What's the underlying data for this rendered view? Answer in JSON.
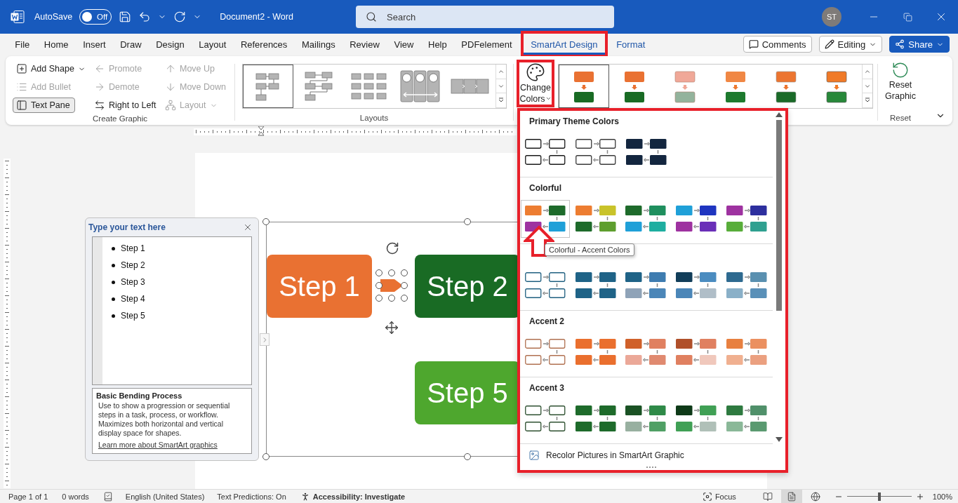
{
  "title_bar": {
    "autosave": {
      "label": "AutoSave",
      "on": false,
      "state": "Off"
    },
    "document_title": "Document2 - Word",
    "search": {
      "placeholder": "Search"
    },
    "avatar": "ST"
  },
  "menu_tabs": [
    {
      "label": "File",
      "selected": false,
      "contextual": false,
      "annotated": false
    },
    {
      "label": "Home",
      "selected": false,
      "contextual": false,
      "annotated": false
    },
    {
      "label": "Insert",
      "selected": false,
      "contextual": false,
      "annotated": false
    },
    {
      "label": "Draw",
      "selected": false,
      "contextual": false,
      "annotated": false
    },
    {
      "label": "Design",
      "selected": false,
      "contextual": false,
      "annotated": false
    },
    {
      "label": "Layout",
      "selected": false,
      "contextual": false,
      "annotated": false
    },
    {
      "label": "References",
      "selected": false,
      "contextual": false,
      "annotated": false
    },
    {
      "label": "Mailings",
      "selected": false,
      "contextual": false,
      "annotated": false
    },
    {
      "label": "Review",
      "selected": false,
      "contextual": false,
      "annotated": false
    },
    {
      "label": "View",
      "selected": false,
      "contextual": false,
      "annotated": false
    },
    {
      "label": "Help",
      "selected": false,
      "contextual": false,
      "annotated": false
    },
    {
      "label": "PDFelement",
      "selected": false,
      "contextual": false,
      "annotated": false
    },
    {
      "label": "SmartArt Design",
      "selected": true,
      "contextual": true,
      "annotated": true
    },
    {
      "label": "Format",
      "selected": false,
      "contextual": true,
      "annotated": false
    }
  ],
  "header_buttons": [
    {
      "label": "Comments",
      "kind": "comments"
    },
    {
      "label": "Editing",
      "kind": "editing"
    },
    {
      "label": "Share",
      "kind": "share"
    }
  ],
  "ribbon": {
    "create_graphic": {
      "label": "Create Graphic",
      "commands": [
        {
          "label": "Add Shape",
          "kind": "add",
          "disabled": false,
          "pressed": false,
          "has_menu": true
        },
        {
          "label": "Add Bullet",
          "kind": "bullet",
          "disabled": true,
          "pressed": false,
          "has_menu": false
        },
        {
          "label": "Text Pane",
          "kind": "pane",
          "disabled": false,
          "pressed": true,
          "has_menu": false
        },
        {
          "label": "Promote",
          "kind": "promote",
          "disabled": true,
          "pressed": false,
          "has_menu": false
        },
        {
          "label": "Demote",
          "kind": "demote",
          "disabled": true,
          "pressed": false,
          "has_menu": false
        },
        {
          "label": "Right to Left",
          "kind": "direction",
          "disabled": false,
          "pressed": false,
          "has_menu": false
        },
        {
          "label": "Move Up",
          "kind": "up",
          "disabled": true,
          "pressed": false,
          "has_menu": false
        },
        {
          "label": "Move Down",
          "kind": "down",
          "disabled": true,
          "pressed": false,
          "has_menu": false
        },
        {
          "label": "Layout",
          "kind": "layout",
          "disabled": true,
          "pressed": false,
          "has_menu": true
        }
      ]
    },
    "layouts": {
      "label": "Layouts",
      "items": [
        {
          "kind": "bending",
          "selected": true
        },
        {
          "kind": "alternating",
          "selected": false
        },
        {
          "kind": "grid",
          "selected": false
        },
        {
          "kind": "circles",
          "selected": false
        },
        {
          "kind": "chevron",
          "selected": false
        }
      ]
    },
    "smartart_styles": {
      "change_colors": {
        "label": "Change Colors",
        "annotated": true
      },
      "items": [
        {
          "kind": "flat",
          "selected": true
        },
        {
          "kind": "flat",
          "selected": false
        },
        {
          "kind": "light",
          "selected": false
        },
        {
          "kind": "gradient",
          "selected": false
        },
        {
          "kind": "shadow",
          "selected": false
        },
        {
          "kind": "glossy",
          "selected": false
        }
      ]
    },
    "reset": {
      "button": "Reset Graphic",
      "label": "Reset"
    }
  },
  "text_pane": {
    "title": "Type your text here",
    "items": [
      "Step 1",
      "Step 2",
      "Step 3",
      "Step 4",
      "Step 5"
    ],
    "layout_name": "Basic Bending Process",
    "description": "Use to show a progression or sequential steps in a task, process, or workflow. Maximizes both horizontal and vertical display space for shapes.",
    "link": "Learn more about SmartArt graphics"
  },
  "smartart": {
    "shapes": [
      {
        "text": "Step 1",
        "color": "#e97132"
      },
      {
        "text": "Step 2",
        "color": "#196b24"
      },
      {
        "text": "Step 5",
        "color": "#4ea72e"
      }
    ]
  },
  "colors_menu": {
    "annotated": true,
    "sections": [
      {
        "title": "Primary Theme Colors",
        "swatches": [
          {
            "kind": "outline",
            "selected": false,
            "boxes": [
              {
                "color": "#1a1a1a"
              },
              {
                "color": "#1a1a1a"
              },
              {
                "color": "#1a1a1a"
              },
              {
                "color": "#1a1a1a"
              }
            ]
          },
          {
            "kind": "outline",
            "selected": false,
            "boxes": [
              {
                "color": "#3a3a3a"
              },
              {
                "color": "#3a3a3a"
              },
              {
                "color": "#3a3a3a"
              },
              {
                "color": "#3a3a3a"
              }
            ]
          },
          {
            "kind": "fill",
            "selected": false,
            "boxes": [
              {
                "color": "#13263f"
              },
              {
                "color": "#13263f"
              },
              {
                "color": "#13263f"
              },
              {
                "color": "#13263f"
              }
            ]
          }
        ]
      },
      {
        "title": "Colorful",
        "swatches": [
          {
            "kind": "fill",
            "selected": true,
            "boxes": [
              {
                "color": "#ed7d31"
              },
              {
                "color": "#1e6b2b"
              },
              {
                "color": "#9e32a0"
              },
              {
                "color": "#1fa0d8"
              }
            ]
          },
          {
            "kind": "fill",
            "selected": false,
            "boxes": [
              {
                "color": "#ed7d31"
              },
              {
                "color": "#c9c32a"
              },
              {
                "color": "#1e6b2b"
              },
              {
                "color": "#5e9e2e"
              }
            ]
          },
          {
            "kind": "fill",
            "selected": false,
            "boxes": [
              {
                "color": "#1e6b2b"
              },
              {
                "color": "#1f8f5e"
              },
              {
                "color": "#1fa0d8"
              },
              {
                "color": "#1eaea0"
              }
            ]
          },
          {
            "kind": "fill",
            "selected": false,
            "boxes": [
              {
                "color": "#1fa0d8"
              },
              {
                "color": "#1f35c0"
              },
              {
                "color": "#9e32a0"
              },
              {
                "color": "#6a2fb8"
              }
            ]
          },
          {
            "kind": "fill",
            "selected": false,
            "boxes": [
              {
                "color": "#9e32a0"
              },
              {
                "color": "#2d2f9e"
              },
              {
                "color": "#58ad3a"
              },
              {
                "color": "#2fa090"
              }
            ]
          }
        ]
      },
      {
        "swatches": [
          {
            "kind": "outline",
            "selected": false,
            "boxes": [
              {
                "color": "#1f5f80"
              },
              {
                "color": "#1f5f80"
              },
              {
                "color": "#1f5f80"
              },
              {
                "color": "#1f5f80"
              }
            ]
          },
          {
            "kind": "fill",
            "selected": false,
            "boxes": [
              {
                "color": "#1f6387"
              },
              {
                "color": "#1f6387"
              },
              {
                "color": "#1f6387"
              },
              {
                "color": "#1f6387"
              }
            ]
          },
          {
            "kind": "fill",
            "selected": false,
            "boxes": [
              {
                "color": "#1f6387"
              },
              {
                "color": "#3e7cb0"
              },
              {
                "color": "#8fa3b8"
              },
              {
                "color": "#4b86b8"
              }
            ]
          },
          {
            "kind": "fill",
            "selected": false,
            "boxes": [
              {
                "color": "#123e5a"
              },
              {
                "color": "#4b8cc0"
              },
              {
                "color": "#4b86b8"
              },
              {
                "color": "#b0bec8"
              }
            ]
          },
          {
            "kind": "fill",
            "selected": false,
            "boxes": [
              {
                "color": "#2e6a90"
              },
              {
                "color": "#5a90b0"
              },
              {
                "color": "#8ab0c8"
              },
              {
                "color": "#5a90b8"
              }
            ]
          }
        ]
      },
      {
        "title": "Accent 2",
        "swatches": [
          {
            "kind": "outline",
            "selected": false,
            "boxes": [
              {
                "color": "#b07050"
              },
              {
                "color": "#b07050"
              },
              {
                "color": "#b07050"
              },
              {
                "color": "#b07050"
              }
            ]
          },
          {
            "kind": "fill",
            "selected": false,
            "boxes": [
              {
                "color": "#ea6f2e"
              },
              {
                "color": "#ea6f2e"
              },
              {
                "color": "#ea6f2e"
              },
              {
                "color": "#ea6f2e"
              }
            ]
          },
          {
            "kind": "fill",
            "selected": false,
            "boxes": [
              {
                "color": "#d0612a"
              },
              {
                "color": "#e08060"
              },
              {
                "color": "#eba898"
              },
              {
                "color": "#e08a70"
              }
            ]
          },
          {
            "kind": "fill",
            "selected": false,
            "boxes": [
              {
                "color": "#b0502a"
              },
              {
                "color": "#e08060"
              },
              {
                "color": "#e08060"
              },
              {
                "color": "#f0c8bc"
              }
            ]
          },
          {
            "kind": "fill",
            "selected": false,
            "boxes": [
              {
                "color": "#e88040"
              },
              {
                "color": "#eb9060"
              },
              {
                "color": "#f0b090"
              },
              {
                "color": "#eba080"
              }
            ]
          }
        ]
      },
      {
        "title": "Accent 3",
        "swatches": [
          {
            "kind": "outline",
            "selected": false,
            "boxes": [
              {
                "color": "#2e5030"
              },
              {
                "color": "#2e5030"
              },
              {
                "color": "#2e5030"
              },
              {
                "color": "#2e5030"
              }
            ]
          },
          {
            "kind": "fill",
            "selected": false,
            "boxes": [
              {
                "color": "#1e6b2b"
              },
              {
                "color": "#1e6b2b"
              },
              {
                "color": "#1e6b2b"
              },
              {
                "color": "#1e6b2b"
              }
            ]
          },
          {
            "kind": "fill",
            "selected": false,
            "boxes": [
              {
                "color": "#1a5224"
              },
              {
                "color": "#2f8a48"
              },
              {
                "color": "#98b0a0"
              },
              {
                "color": "#50a065"
              }
            ]
          },
          {
            "kind": "fill",
            "selected": false,
            "boxes": [
              {
                "color": "#0e3a18"
              },
              {
                "color": "#40a055"
              },
              {
                "color": "#40a055"
              },
              {
                "color": "#b0c0b8"
              }
            ]
          },
          {
            "kind": "fill",
            "selected": false,
            "boxes": [
              {
                "color": "#2e7a40"
              },
              {
                "color": "#50906a"
              },
              {
                "color": "#8ab898"
              },
              {
                "color": "#5a9a70"
              }
            ]
          }
        ]
      }
    ],
    "footer": "Recolor Pictures in SmartArt Graphic"
  },
  "tooltip": "Colorful - Accent Colors",
  "status_bar": {
    "page": "Page 1 of 1",
    "words": "0 words",
    "language": "English (United States)",
    "predictions": "Text Predictions: On",
    "accessibility": "Accessibility: Investigate",
    "focus": "Focus",
    "views": [
      {
        "kind": "read",
        "selected": false
      },
      {
        "kind": "print",
        "selected": true
      },
      {
        "kind": "web",
        "selected": false
      }
    ],
    "zoom": {
      "level": 0.5,
      "percent": "100%"
    }
  }
}
